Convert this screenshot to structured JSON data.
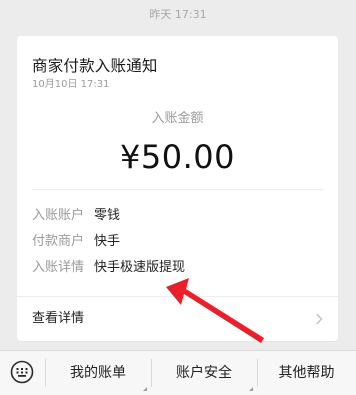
{
  "header": {
    "timestamp": "昨天 17:31"
  },
  "card": {
    "title": "商家付款入账通知",
    "time": "10月10日 17:31",
    "amount_label": "入账金额",
    "amount_value": "¥50.00",
    "details": [
      {
        "label": "入账账户",
        "value": "零钱"
      },
      {
        "label": "付款商户",
        "value": "快手"
      },
      {
        "label": "入账详情",
        "value": "快手极速版提现"
      }
    ],
    "view_details_label": "查看详情"
  },
  "bottom_bar": {
    "tabs": [
      {
        "label": "我的账单"
      },
      {
        "label": "账户安全"
      },
      {
        "label": "其他帮助"
      }
    ]
  },
  "icons": {
    "keyboard": "keyboard-icon",
    "chevron": "chevron-right-icon",
    "annotation": "red-arrow-annotation"
  },
  "colors": {
    "background": "#ececec",
    "card": "#ffffff",
    "annotation_arrow": "#ea1f2b"
  }
}
